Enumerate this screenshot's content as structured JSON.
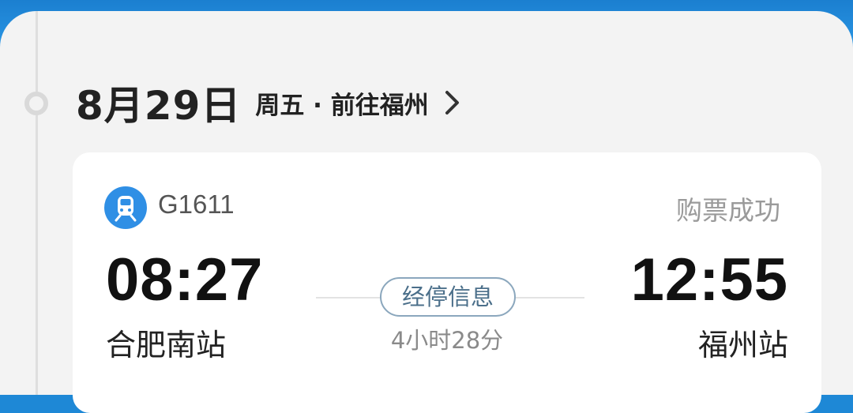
{
  "header": {
    "date": "8月29日",
    "subtitle": "周五 · 前往福州"
  },
  "ticket": {
    "train_number": "G1611",
    "status": "购票成功",
    "departure_time": "08:27",
    "departure_station": "合肥南站",
    "arrival_time": "12:55",
    "arrival_station": "福州站",
    "stop_info_label": "经停信息",
    "duration": "4小时28分"
  },
  "colors": {
    "accent_blue": "#2f8fe5",
    "stop_badge": "#4b6f8a"
  },
  "icons": {
    "train": "train-icon",
    "chevron": "chevron-right-icon"
  }
}
